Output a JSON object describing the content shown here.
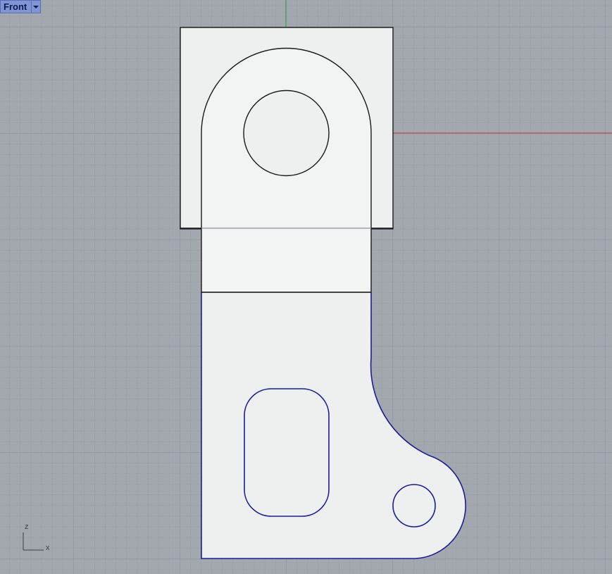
{
  "viewport": {
    "name": "Front",
    "menu_icon": "chevron-down-icon"
  },
  "axes_widget": {
    "vertical": "z",
    "horizontal": "x"
  },
  "colors": {
    "background": "#a3a7ae",
    "grid_minor": "#999da4",
    "grid_major": "#8c9097",
    "x_axis": "#b04a4a",
    "z_axis": "#3e9a4a",
    "shape_fill": "#eef0f0",
    "shape_stroke": "#1a1a1a",
    "selected_stroke": "#1c1c9a",
    "tab_bg": "#7f95d6"
  }
}
